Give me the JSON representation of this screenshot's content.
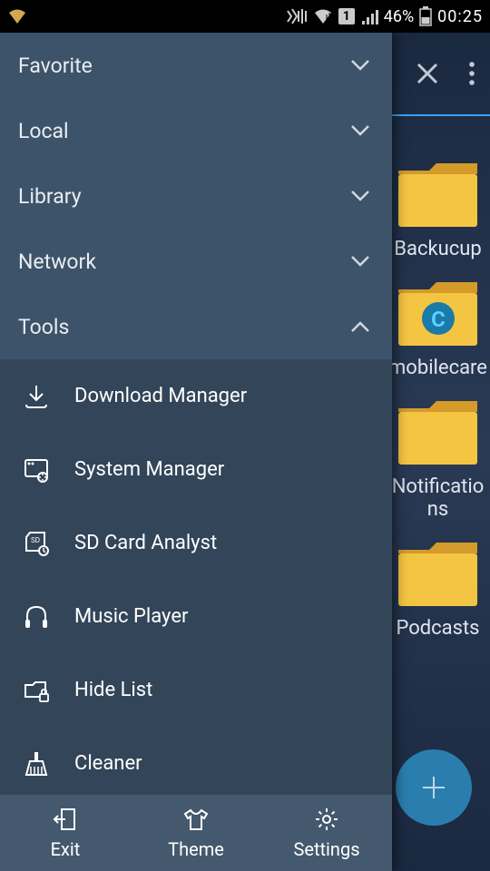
{
  "status": {
    "battery_pct": "46%",
    "clock": "00:25",
    "sim": "1"
  },
  "drawer": {
    "sections": {
      "favorite": "Favorite",
      "local": "Local",
      "library": "Library",
      "network": "Network",
      "tools": "Tools"
    },
    "tools_items": {
      "download_manager": "Download Manager",
      "system_manager": "System Manager",
      "sd_card_analyst": "SD Card Analyst",
      "music_player": "Music Player",
      "hide_list": "Hide List",
      "cleaner": "Cleaner"
    },
    "bottom": {
      "exit": "Exit",
      "theme": "Theme",
      "settings": "Settings"
    }
  },
  "background": {
    "folders": {
      "backucup": "Backucup",
      "mobilecare": "mobilecare",
      "notifications": "Notifications",
      "podcasts": "Podcasts"
    }
  }
}
